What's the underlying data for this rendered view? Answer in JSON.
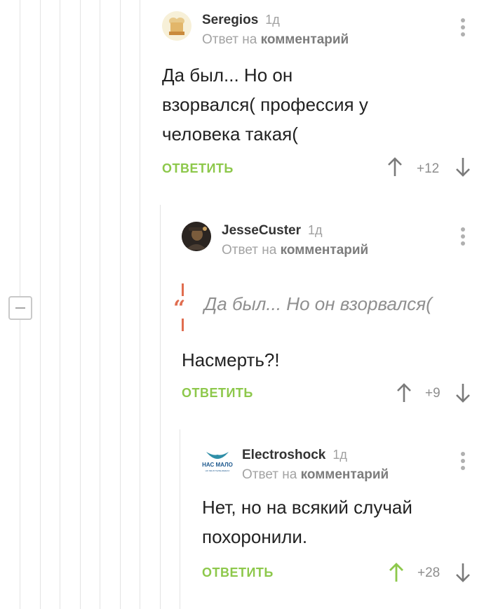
{
  "comments": [
    {
      "author": "Seregios",
      "time": "1д",
      "reply_to_prefix": "Ответ на",
      "reply_to_link": "комментарий",
      "body": [
        "Да был... Но он",
        "взорвался( профессия у",
        "человека такая("
      ],
      "reply_label": "ОТВЕТИТЬ",
      "rating": "+12",
      "avatar_icon": "chef-hat-avatar-icon"
    },
    {
      "author": "JesseCuster",
      "time": "1д",
      "reply_to_prefix": "Ответ на",
      "reply_to_link": "комментарий",
      "quote": "Да был... Но он взорвался(",
      "body": [
        "Насмерть?!"
      ],
      "reply_label": "ОТВЕТИТЬ",
      "rating": "+9",
      "avatar_icon": "portrait-avatar-icon"
    },
    {
      "author": "Electroshock",
      "time": "1д",
      "reply_to_prefix": "Ответ на",
      "reply_to_link": "комментарий",
      "body": [
        "Нет, но на всякий случай",
        "похоронили."
      ],
      "reply_label": "ОТВЕТИТЬ",
      "rating": "+28",
      "avatar_icon": "nas-malo-logo-icon",
      "avatar_text": "НАС МАЛО",
      "avatar_subtext": "НО МЫ В ТЕЛЬНЯШКАХ",
      "upvoted": true
    }
  ],
  "colors": {
    "accent_green": "#8dc84b",
    "quote_orange": "#e06d4f",
    "muted_text": "#a3a3a3"
  }
}
